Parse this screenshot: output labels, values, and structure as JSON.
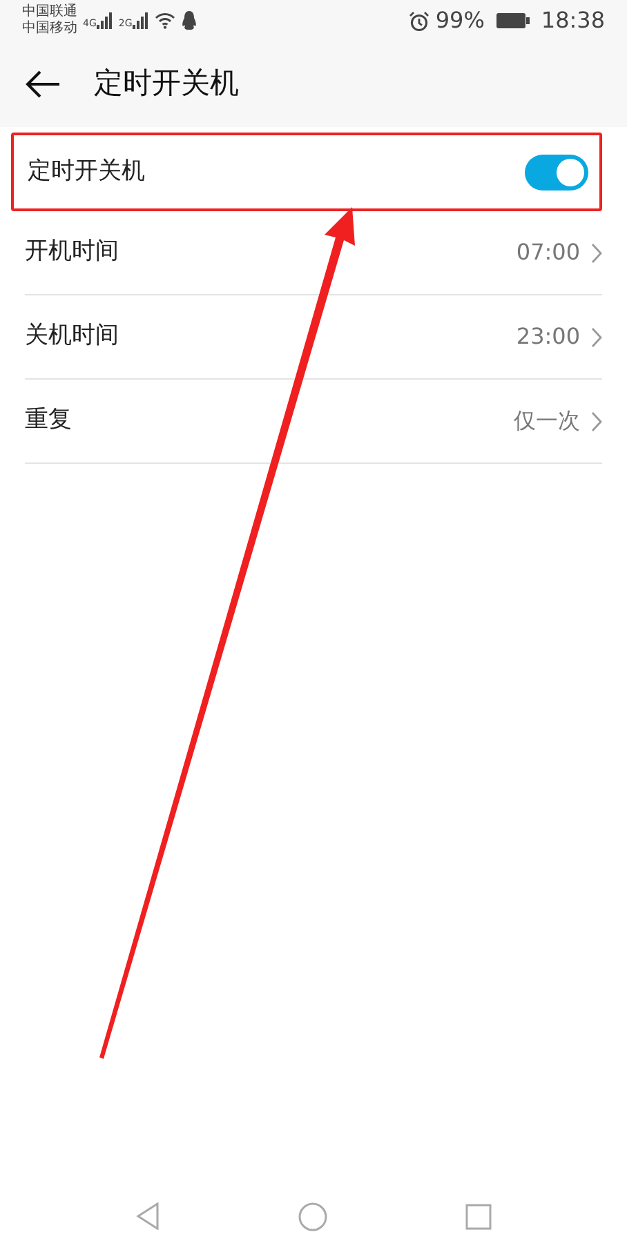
{
  "status_bar": {
    "carriers": [
      "中国联通",
      "中国移动"
    ],
    "networks": [
      "4G",
      "2G"
    ],
    "battery": "99%",
    "time": "18:38"
  },
  "header": {
    "title": "定时开关机"
  },
  "settings": [
    {
      "kind": "toggle",
      "label": "定时开关机",
      "on": true,
      "highlighted": true
    },
    {
      "kind": "link",
      "label": "开机时间",
      "value": "07:00",
      "highlighted": false
    },
    {
      "kind": "link",
      "label": "关机时间",
      "value": "23:00",
      "highlighted": false
    },
    {
      "kind": "link",
      "label": "重复",
      "value": "仅一次",
      "highlighted": false
    }
  ]
}
